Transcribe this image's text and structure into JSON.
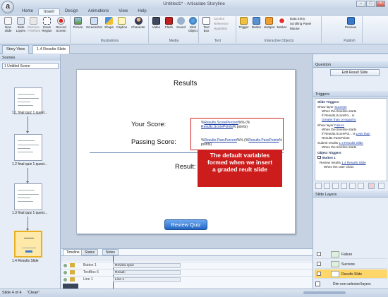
{
  "app": {
    "title": "Untitled1* - Articulate Storyline",
    "logo_letter": "a"
  },
  "ribbon": {
    "tabs": [
      "Home",
      "Insert",
      "Design",
      "Animations",
      "View",
      "Help"
    ],
    "active_tab": "Insert",
    "groups": {
      "slide": {
        "new_slide": "New Slide",
        "slide_layers": "Slide Layers",
        "remove_freeform": "Remove Freeform",
        "zoom_region": "Zoom Region",
        "record_screen": "Record Screen"
      },
      "illustrations": {
        "label": "Illustrations",
        "picture": "Picture",
        "screenshot": "Screenshot",
        "shape": "Shape",
        "caption": "Caption",
        "character": "Character"
      },
      "media": {
        "label": "Media",
        "video": "Video",
        "flash": "Flash",
        "sound": "Sound",
        "web_object": "Web Object"
      },
      "text": {
        "label": "Text",
        "text_box": "Text Box",
        "symbol": "Symbol",
        "reference": "Reference",
        "hyperlink": "Hyperlink"
      },
      "interactive": {
        "label": "Interactive Objects",
        "trigger": "Trigger",
        "button": "Button",
        "hotspot": "Hotspot",
        "marker": "Marker",
        "data_entry": "Data Entry",
        "scrolling_panel": "Scrolling Panel",
        "mouse": "Mouse"
      },
      "publish": {
        "label": "Publish",
        "preview": "Preview"
      }
    }
  },
  "doc_tabs": [
    "Story View",
    "1.4 Results Slide"
  ],
  "scenes_panel": {
    "header": "Scenes",
    "scene_select": "1 Untitled Scene",
    "slides": [
      "1.1 final quiz 1 quest...",
      "1.2 final quiz 1 quest...",
      "1.3 final quiz 1 quest...",
      "1.4 Results Slide"
    ]
  },
  "slide": {
    "title": "Results",
    "your_score_label": "Your Score:",
    "passing_score_label": "Passing Score:",
    "result_label": "Result:",
    "score_var_line1_prefix": "%",
    "score_var_line1_link": "Results.ScorePercent",
    "score_var_line1_suffix": "%% (%",
    "score_var_line2_link": "Results.ScorePoints",
    "score_var_line2_suffix": "% points)",
    "pass_var_line1_prefix": "%",
    "pass_var_line1_link": "Results.PassPercent",
    "pass_var_line1_mid": "%% (%",
    "pass_var_line1_link2": "Results.PassPoints",
    "pass_var_line1_suffix": "%",
    "pass_var_line2": "points)",
    "callout_line1": "The default variables",
    "callout_line2": "formed when we insert",
    "callout_line3": "a graded reult slide",
    "review_button": "Review Quiz"
  },
  "timeline": {
    "tabs": [
      "Timeline",
      "States",
      "Notes"
    ],
    "active_tab": "Timeline",
    "rows": [
      {
        "name": "Button 1",
        "bar": "Review Quiz"
      },
      {
        "name": "TextBox 6",
        "bar": "Result:"
      },
      {
        "name": "Line 1",
        "bar": "Line 1"
      }
    ]
  },
  "question_panel": {
    "header": "Question",
    "edit_button": "Edit Result Slide"
  },
  "triggers_panel": {
    "header": "Triggers",
    "slide_triggers_heading": "Slide Triggers",
    "object_triggers_heading": "Object Triggers",
    "t1_a": "Show layer ",
    "t1_link": "Success",
    "t1_b": "When the timeline starts",
    "t1_c": "If Results.ScorePo... is ",
    "t1_c_link": "Greater than or equal to",
    "t2_a": "Show layer ",
    "t2_link": "Failure",
    "t2_b": "When the timeline starts",
    "t2_c": "If Results.ScorePoi... is ",
    "t2_c_link": "Less than",
    "t2_d": "Results.PassPoints",
    "t3_a": "Submit results ",
    "t3_link": "1.4 Results Slide",
    "t3_b": "When the timeline starts",
    "button_item": "Button 1",
    "t4_a": "Review results ",
    "t4_link": "1.4 Results Slide",
    "t4_b": "When the user clicks"
  },
  "layers_panel": {
    "header": "Slide Layers",
    "layers": [
      "Failure",
      "Success",
      "Results Slide"
    ],
    "dim_label": "Dim non-selected layers"
  },
  "status": {
    "slide_info": "Slide 4 of 4",
    "theme": "\"Clean\""
  },
  "colors": {
    "accent_red": "#cc1c1c",
    "review_button": "#2468c4",
    "selected_thumb": "#e8b020"
  }
}
